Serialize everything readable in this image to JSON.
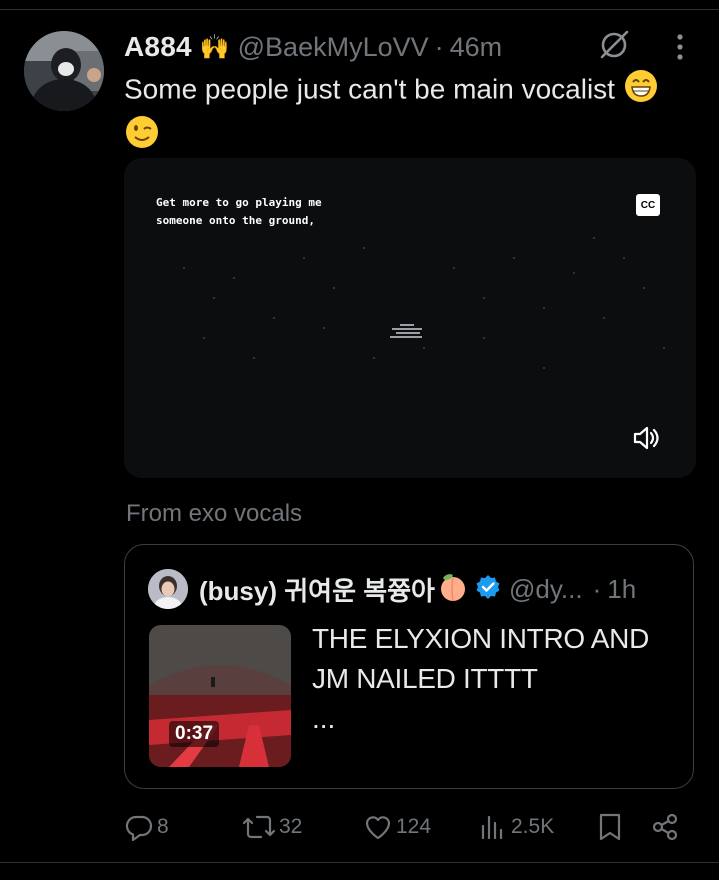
{
  "tweet": {
    "display_name": "A884",
    "name_emoji": "🙌",
    "handle": "@BaekMyLoVV",
    "separator": "·",
    "time": "46m",
    "text": "Some people just can't be main vocalist"
  },
  "video": {
    "subtitle_line1": "Get more to go playing me",
    "subtitle_line2": "someone onto the ground,",
    "cc_label": "CC"
  },
  "source_label": "From exo vocals",
  "quote": {
    "display_name": "(busy) 귀여운 복쯍아",
    "handle": "@dy...",
    "separator": "·",
    "time": "1h",
    "text": "THE ELYXION INTRO AND JM NAILED ITTTT",
    "ellipsis": "...",
    "duration": "0:37"
  },
  "actions": {
    "replies": "8",
    "reposts": "32",
    "likes": "124",
    "views": "2.5K"
  },
  "colors": {
    "background": "#000000",
    "text_primary": "#e7e9ea",
    "text_secondary": "#71767b",
    "verified_blue": "#1d9bf0",
    "border": "#2f3336"
  }
}
